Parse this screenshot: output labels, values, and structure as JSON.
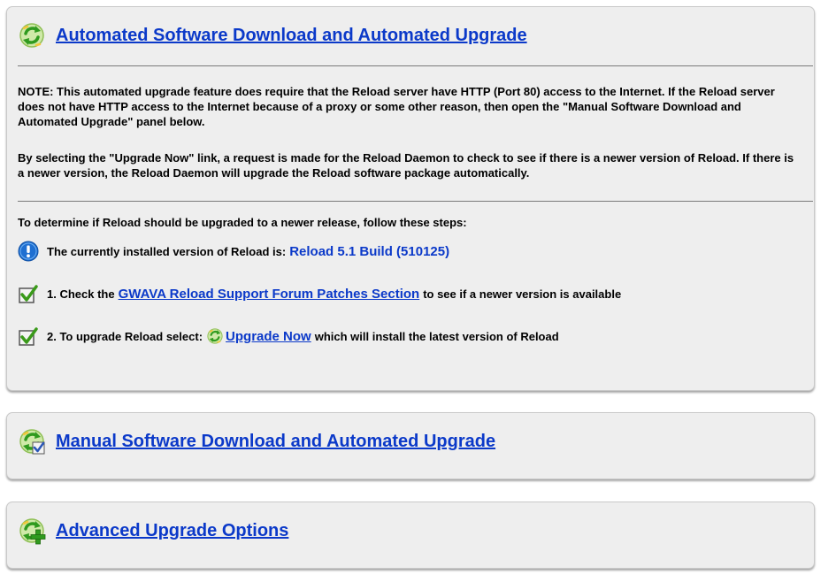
{
  "colors": {
    "link": "#0b39c9",
    "panel_bg": "#eeeeee",
    "info_icon": "#1f6fd1",
    "check_icon": "#3a9a1a"
  },
  "automated": {
    "icon": "green-refresh-arrows-icon",
    "title": "Automated Software Download and Automated Upgrade",
    "note": "NOTE: This automated upgrade feature does require that the Reload server have HTTP (Port 80) access to the Internet. If the Reload server does not have HTTP access to the Internet because of a proxy or some other reason, then open the \"Manual Software Download and Automated Upgrade\" panel below.",
    "description": "By selecting the \"Upgrade Now\" link, a request is made for the Reload Daemon to check to see if there is a newer version of Reload. If there is a newer version, the Reload Daemon will upgrade the Reload software package automatically.",
    "steps_intro": "To determine if Reload should be upgraded to a newer release,  follow these steps:",
    "installed_label": "The currently installed version of Reload is:",
    "installed_version": "Reload 5.1 Build (510125)",
    "step1_prefix": "1. Check the",
    "step1_link": "GWAVA Reload Support Forum Patches Section",
    "step1_suffix": "to see if a newer version is available",
    "step2_prefix": "2. To upgrade Reload select:",
    "step2_link": "Upgrade Now",
    "step2_suffix": "which will install the latest version of Reload"
  },
  "manual": {
    "icon": "green-refresh-with-checkmark-icon",
    "title": "Manual Software Download and Automated Upgrade"
  },
  "advanced": {
    "icon": "green-refresh-with-plus-icon",
    "title": "Advanced Upgrade Options"
  }
}
